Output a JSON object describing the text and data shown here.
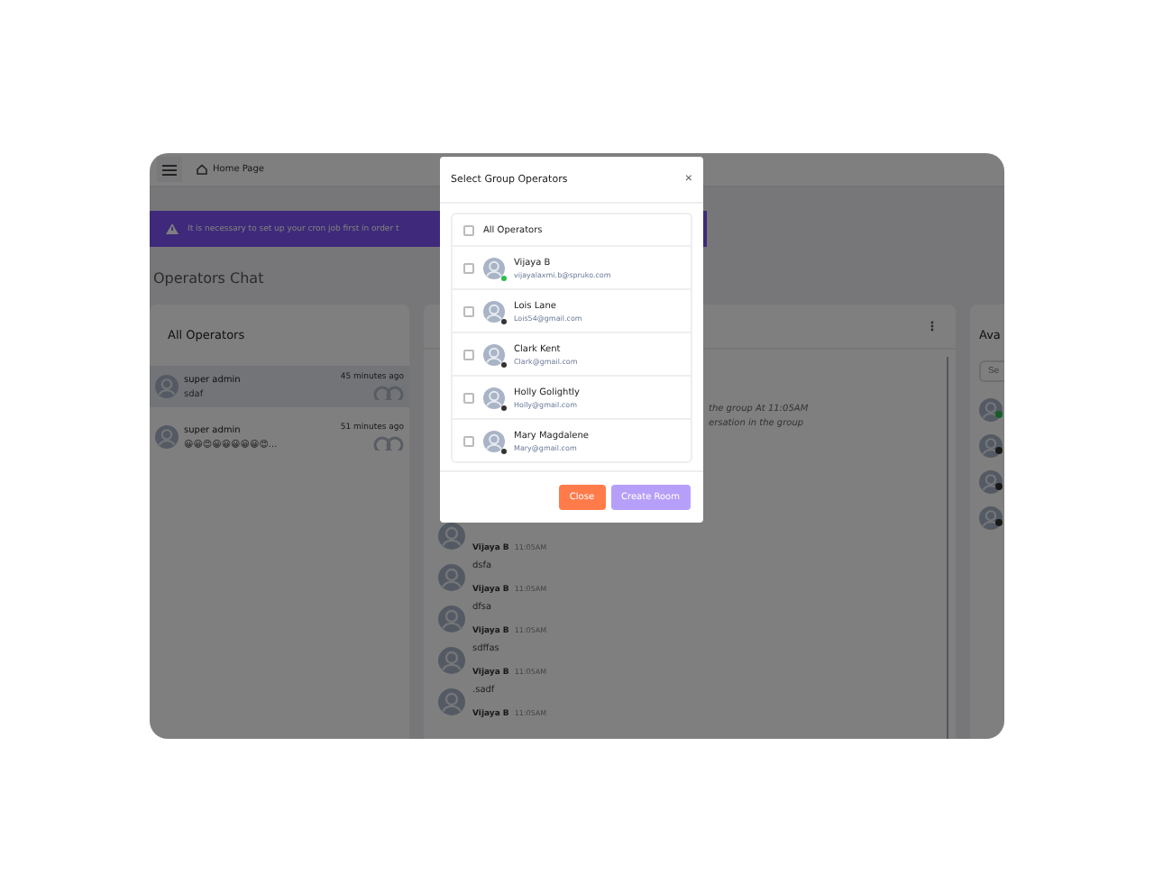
{
  "header": {
    "breadcrumb": "Home Page"
  },
  "banner": {
    "text": "It is necessary to set up your cron job first in order t"
  },
  "page_title": "Operators Chat",
  "all_operators": {
    "title": "All Operators",
    "chats": [
      {
        "name": "super admin",
        "time": "45 minutes ago",
        "preview": "sdaf",
        "selected": true
      },
      {
        "name": "super admin",
        "time": "51 minutes ago",
        "preview": "😀😀😍😀😀😀😀😀😍...",
        "selected": false
      }
    ]
  },
  "chat": {
    "notice_lines": [
      "the group At 11:05AM",
      "ersation in the group"
    ],
    "messages": [
      {
        "name": "Vijaya B",
        "time": "11:05AM",
        "text": "dsfa"
      },
      {
        "name": "Vijaya B",
        "time": "11:05AM",
        "text": "dfsa"
      },
      {
        "name": "Vijaya B",
        "time": "11:05AM",
        "text": "sdffas"
      },
      {
        "name": "Vijaya B",
        "time": "11:05AM",
        "text": ".sadf"
      },
      {
        "name": "Vijaya B",
        "time": "11:05AM"
      }
    ]
  },
  "available": {
    "title": "Ava",
    "search": {
      "placeholder": "Se"
    },
    "operators": [
      {
        "online": true
      },
      {
        "online": false
      },
      {
        "online": false
      },
      {
        "online": false
      }
    ]
  },
  "modal": {
    "title": "Select Group Operators",
    "close": "×",
    "select_all": {
      "label": "All Operators",
      "checked": false
    },
    "operators": [
      {
        "name": "Vijaya B",
        "email": "vijayalaxmi.b@spruko.com",
        "online": true,
        "checked": false
      },
      {
        "name": "Lois Lane",
        "email": "Lois54@gmail.com",
        "online": false,
        "checked": false
      },
      {
        "name": "Clark Kent",
        "email": "Clark@gmail.com",
        "online": false,
        "checked": false
      },
      {
        "name": "Holly Golightly",
        "email": "Holly@gmail.com",
        "online": false,
        "checked": false
      },
      {
        "name": "Mary Magdalene",
        "email": "Mary@gmail.com",
        "online": false,
        "checked": false
      }
    ],
    "buttons": [
      {
        "label": "Close",
        "kind": "cancel",
        "disabled": false
      },
      {
        "label": "Create Room",
        "kind": "primary",
        "disabled": true
      }
    ]
  }
}
